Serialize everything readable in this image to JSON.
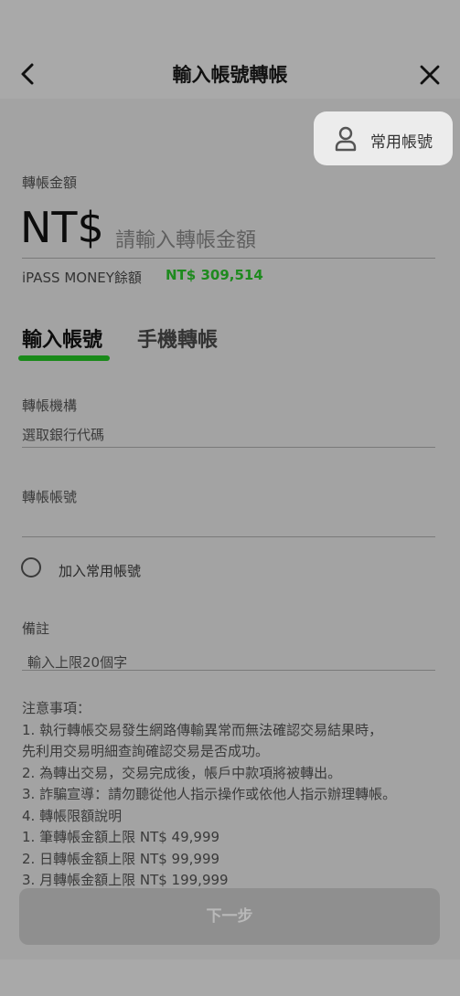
{
  "header": {
    "title": "輸入帳號轉帳"
  },
  "favorites": {
    "label": "常用帳號"
  },
  "amount": {
    "label": "轉帳金額",
    "currency": "NT$",
    "placeholder": "請輸入轉帳金額"
  },
  "balance": {
    "label": "iPASS MONEY餘額",
    "value": "NT$ 309,514"
  },
  "tabs": [
    {
      "label": "輸入帳號",
      "active": true
    },
    {
      "label": "手機轉帳",
      "active": false
    }
  ],
  "form": {
    "bank": {
      "label": "轉帳機構",
      "placeholder": "選取銀行代碼"
    },
    "account": {
      "label": "轉帳帳號",
      "placeholder": ""
    },
    "add_favorite": {
      "label": "加入常用帳號",
      "checked": false
    },
    "memo": {
      "label": "備註",
      "placeholder": "輸入上限20個字"
    }
  },
  "notes": {
    "title": "注意事項：",
    "lines": [
      "1. 執行轉帳交易發生網路傳輸異常而無法確認交易結果時，",
      "先利用交易明細查詢確認交易是否成功。",
      "2. 為轉出交易，交易完成後，帳戶中款項將被轉出。",
      "3. 詐騙宣導：請勿聽從他人指示操作或依他人指示辦理轉帳。",
      "4. 轉帳限額說明",
      "1. 筆轉帳金額上限 NT$ 49,999",
      "2. 日轉帳金額上限 NT$ 99,999",
      "3. 月轉帳金額上限 NT$ 199,999"
    ]
  },
  "footer": {
    "next_label": "下一步"
  },
  "colors": {
    "accent_green": "#1a8a1a",
    "balance_green": "#1e8a1e"
  }
}
